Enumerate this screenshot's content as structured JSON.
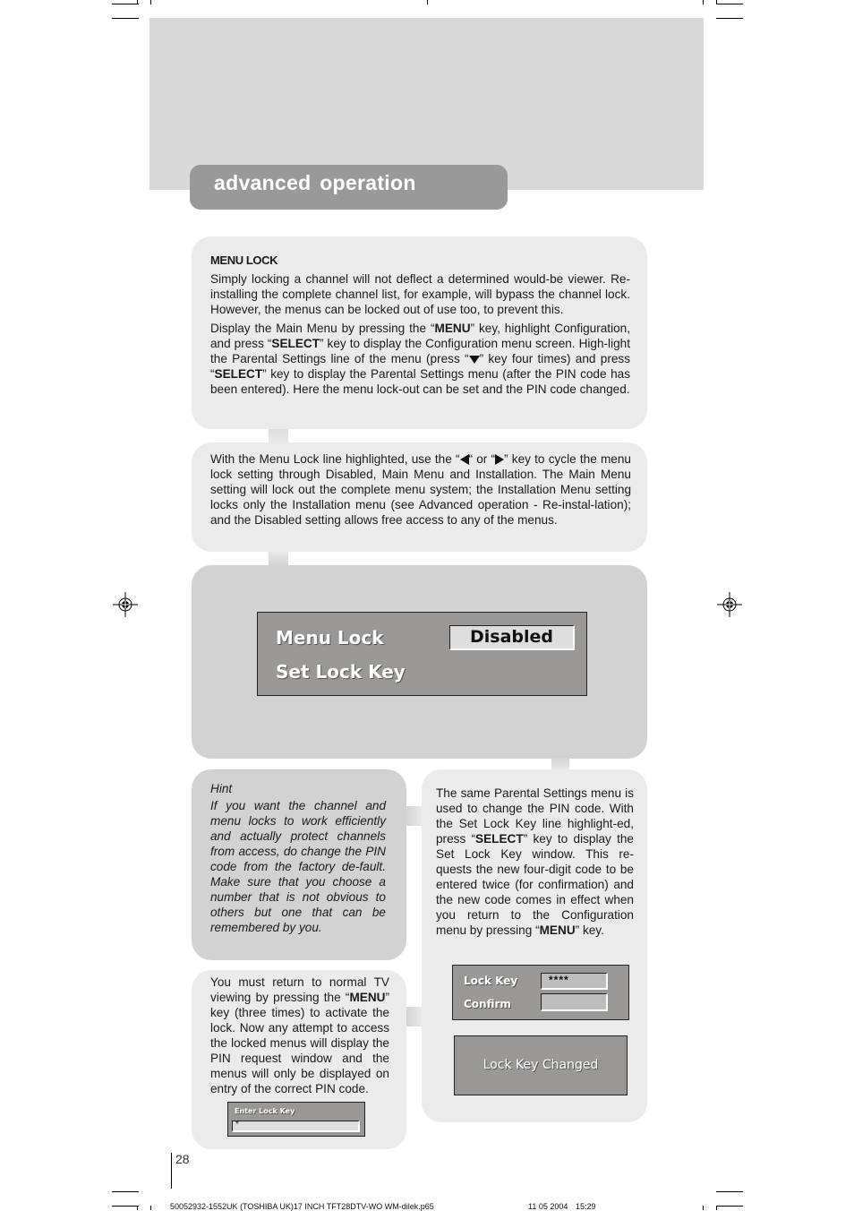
{
  "page": {
    "section_title": "advanced operation",
    "page_number": "28"
  },
  "menu_lock_panel": {
    "heading": "MENU LOCK",
    "para1": "Simply locking a channel will not deflect a determined would-be viewer. Re-installing the complete channel list, for example, will bypass the channel lock. However, the menus can be locked out of use too, to prevent this.",
    "para2_parts": {
      "a": "Display the Main Menu by pressing the “",
      "menu": "MENU",
      "b": "” key, highlight Configuration, and press “",
      "select1": "SELECT",
      "c": "” key to display the Configuration menu screen. High-light the Parental Settings line of the menu (press “",
      "down_key_icon": "down-arrow-icon",
      "d": "” key four times) and press “",
      "select2": "SELECT",
      "e": "” key to display the Parental Settings menu (after the PIN code has been entered). Here the menu lock-out can be set and the PIN code changed."
    }
  },
  "cycle_panel": {
    "a": "With the Menu Lock line highlighted, use the “",
    "left_key_icon": "left-arrow-icon",
    "b": "“ or “",
    "right_key_icon": "right-arrow-icon",
    "c": "” key to cycle the menu lock setting through Disabled, Main Menu and Installation. The Main Menu setting will lock out the complete menu system; the Installation Menu setting locks only the Installation menu (see Advanced operation - Re-instal-lation); and the Disabled setting allows free access to any of the menus."
  },
  "osd_parental": {
    "row1_label": "Menu Lock",
    "row1_value": "Disabled",
    "row2_label": "Set Lock Key"
  },
  "hint_panel": {
    "title": "Hint",
    "body": "If you want the channel and menu locks to work efficiently and actually protect channels from access, do change the PIN code from the factory de-fault. Make sure that you choose a number that is not obvious to others but one that can be remembered by you."
  },
  "pin_panel": {
    "a": "The same Parental Settings menu is used to change the PIN code. With the Set Lock Key line highlight-ed, press “",
    "select": "SELECT",
    "b": "” key to display the Set Lock Key window. This re-quests the new four-digit code to be entered twice (for confirmation) and the new code comes in effect when you return to the Configuration menu by pressing “",
    "menu": "MENU",
    "c": "” key."
  },
  "osd_lock_key": {
    "lock_key_label": "Lock Key",
    "lock_key_value": "****",
    "confirm_label": "Confirm",
    "confirm_value": ""
  },
  "osd_changed": {
    "message": "Lock Key Changed"
  },
  "return_panel": {
    "a": "You must return to normal TV viewing by pressing the “",
    "menu": "MENU",
    "b": "” key (three times) to activate the lock. Now any attempt to access the locked menus will display the PIN request window and the menus will only be displayed on entry of the correct PIN code."
  },
  "osd_enter_key": {
    "label": "Enter Lock Key",
    "value": "*"
  },
  "footer": {
    "file_info": "50052932-1552UK (TOSHIBA UK)17 INCH TFT28DTV-WO WM-dilek.p65",
    "page_slug": "28",
    "date": "11 05 2004",
    "time": "15:29"
  },
  "colors": {
    "header_band": "#d9d9d9",
    "section_tab": "#999999",
    "light_panel": "#ebebeb",
    "mid_panel": "#d2d2d2",
    "osd_bg": "#999896"
  }
}
